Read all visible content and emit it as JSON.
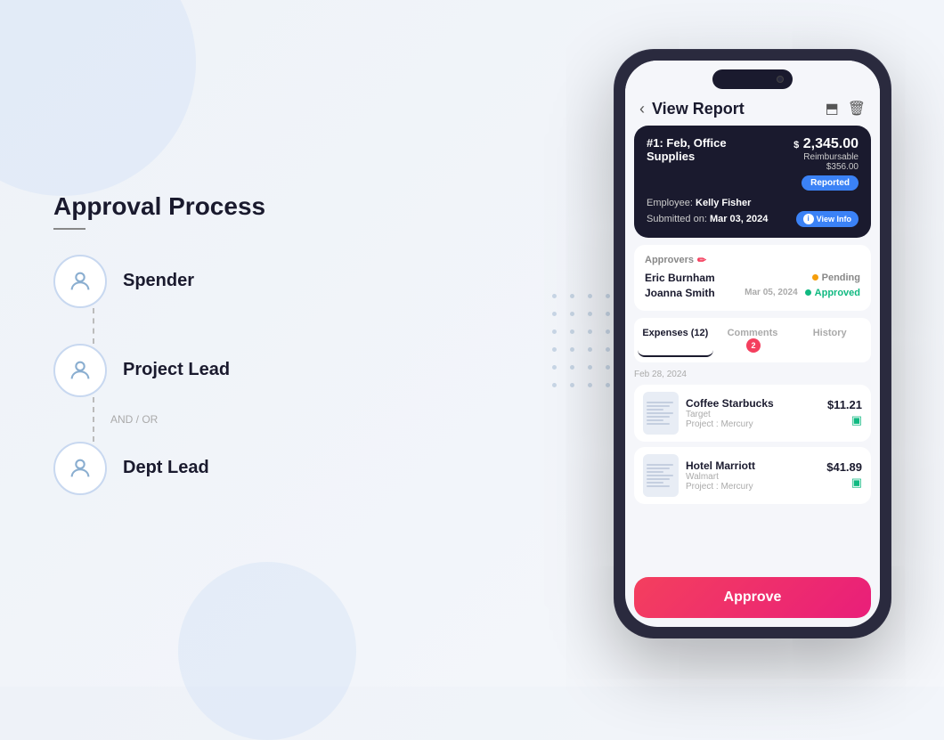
{
  "left_panel": {
    "title": "Approval Process",
    "steps": [
      {
        "id": "spender",
        "label": "Spender"
      },
      {
        "id": "project-lead",
        "label": "Project Lead"
      },
      {
        "id": "dept-lead",
        "label": "Dept Lead"
      }
    ],
    "connector_label": "AND / OR"
  },
  "phone": {
    "header": {
      "title": "View Report",
      "back_label": "‹"
    },
    "report_card": {
      "number": "#1: Feb, Office Supplies",
      "amount_label": "$",
      "amount": "2,345.00",
      "reimbursable_label": "Reimbursable",
      "reimbursable_amount": "$356.00",
      "status_badge": "Reported",
      "employee_label": "Employee:",
      "employee_name": "Kelly Fisher",
      "submitted_label": "Submitted on:",
      "submitted_date": "Mar 03, 2024",
      "view_info_label": "View Info"
    },
    "approvers": {
      "section_title": "Approvers",
      "items": [
        {
          "name": "Eric Burnham",
          "date": "",
          "status": "Pending",
          "status_type": "pending"
        },
        {
          "name": "Joanna Smith",
          "date": "Mar 05, 2024",
          "status": "Approved",
          "status_type": "approved"
        }
      ]
    },
    "tabs": [
      {
        "id": "expenses",
        "label": "Expenses (12)",
        "active": true
      },
      {
        "id": "comments",
        "label": "Comments",
        "badge": "2",
        "active": false
      },
      {
        "id": "history",
        "label": "History",
        "active": false
      }
    ],
    "expense_date": "Feb 28, 2024",
    "expenses": [
      {
        "id": "exp1",
        "name": "Coffee Starbucks",
        "sub": "Target",
        "project": "Project : Mercury",
        "amount": "$11.21"
      },
      {
        "id": "exp2",
        "name": "Hotel Marriott",
        "sub": "Walmart",
        "project": "Project : Mercury",
        "amount": "$41.89"
      }
    ],
    "approve_button_label": "Approve"
  }
}
